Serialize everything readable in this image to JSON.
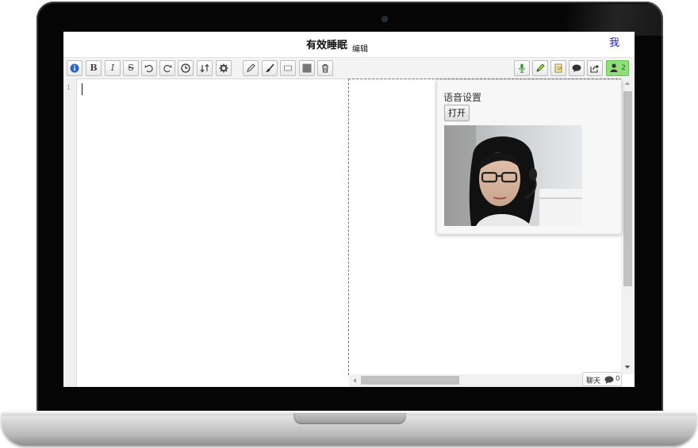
{
  "header": {
    "title": "有效睡眠",
    "edit_label": "编辑",
    "user_link": "我"
  },
  "toolbar_left": [
    {
      "name": "info-icon",
      "label": "i"
    },
    {
      "name": "bold-icon",
      "label": "B"
    },
    {
      "name": "italic-icon",
      "label": "I"
    },
    {
      "name": "strikethrough-icon",
      "label": "S"
    },
    {
      "name": "undo-icon",
      "label": ""
    },
    {
      "name": "redo-icon",
      "label": ""
    },
    {
      "name": "clock-icon",
      "label": ""
    },
    {
      "name": "sort-icon",
      "label": ""
    },
    {
      "name": "gear-icon",
      "label": ""
    },
    {
      "name": "pencil-icon",
      "label": ""
    },
    {
      "name": "brush-icon",
      "label": ""
    },
    {
      "name": "rectangle-icon",
      "label": ""
    },
    {
      "name": "filled-square-icon",
      "label": ""
    },
    {
      "name": "trash-icon",
      "label": ""
    }
  ],
  "toolbar_right": [
    {
      "name": "microphone-icon"
    },
    {
      "name": "highlighter-icon"
    },
    {
      "name": "notepad-icon"
    },
    {
      "name": "speech-bubble-icon"
    },
    {
      "name": "share-icon"
    },
    {
      "name": "users-icon",
      "count": "2"
    }
  ],
  "editor": {
    "line_numbers": [
      "1"
    ],
    "content": ""
  },
  "voice_panel": {
    "title": "语音设置",
    "open_button": "打开"
  },
  "chat": {
    "label": "聊天",
    "count": "0"
  },
  "colors": {
    "link": "#1a1adf",
    "info_blue": "#2a63d6",
    "mic_green": "#2e9a2e",
    "active_users_bg": "#8fe07a"
  }
}
